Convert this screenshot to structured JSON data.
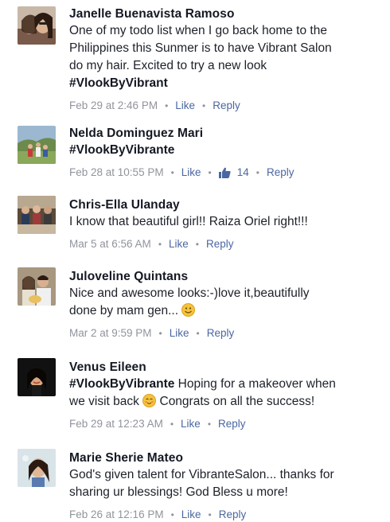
{
  "comments": [
    {
      "name": "Janelle Buenavista Ramoso",
      "lines": [
        "One of my todo list when I go back home to the",
        "Philippines this Sunmer is to have Vibrant Salon",
        "do my hair. Excited to try a new look"
      ],
      "hashtag": "#VlookByVibrant",
      "timestamp": "Feb 29 at 2:46 PM",
      "like_label": "Like",
      "reply_label": "Reply"
    },
    {
      "name": "Nelda Dominguez Mari",
      "hashtag": "#VlookByVibrante",
      "timestamp": "Feb 28 at 10:55 PM",
      "like_label": "Like",
      "like_count": "14",
      "reply_label": "Reply"
    },
    {
      "name": "Chris-Ella Ulanday",
      "lines": [
        "I know that beautiful girl!! Raiza Oriel right!!!"
      ],
      "timestamp": "Mar 5 at 6:56 AM",
      "like_label": "Like",
      "reply_label": "Reply"
    },
    {
      "name": "Juloveline Quintans",
      "lines": [
        "Nice and awesome looks:-)love it,beautifully",
        "done by mam gen..."
      ],
      "timestamp": "Mar 2 at 9:59 PM",
      "like_label": "Like",
      "reply_label": "Reply"
    },
    {
      "name": "Venus Eileen",
      "hashtag": "#VlookByVibrante",
      "text_after_tag": " Hoping for a makeover when",
      "line2": "we visit back",
      "line2_after_emoji": " Congrats on all the success!",
      "timestamp": "Feb 29 at 12:23 AM",
      "like_label": "Like",
      "reply_label": "Reply"
    },
    {
      "name": "Marie Sherie Mateo",
      "lines": [
        "God's given talent for VibranteSalon... thanks for",
        "sharing ur blessings! God Bless u more!"
      ],
      "timestamp": "Feb 26 at 12:16 PM",
      "like_label": "Like",
      "reply_label": "Reply"
    }
  ],
  "icons": {
    "thumbs_up": "thumbs-up-icon",
    "smiley": "smiley-emoji-icon"
  },
  "colors": {
    "link": "#4b67a1",
    "meta": "#90949c",
    "text": "#1d2129"
  }
}
